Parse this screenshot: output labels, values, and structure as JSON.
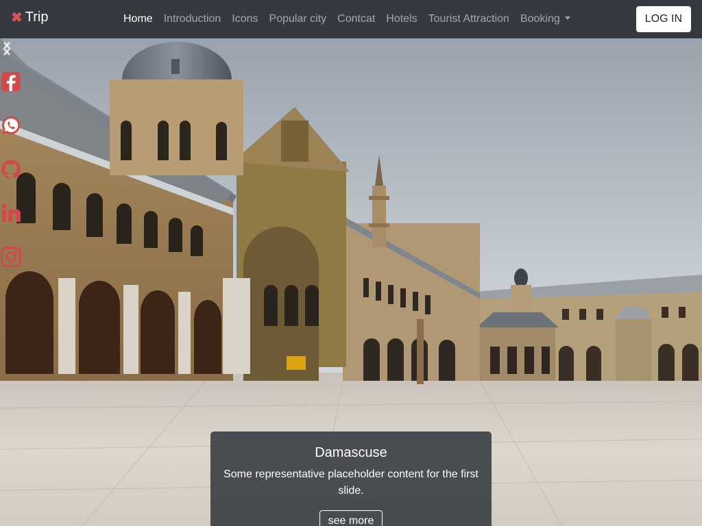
{
  "navbar": {
    "brand": {
      "icon": "x-mark-icon",
      "label": "Trip"
    },
    "links": [
      {
        "label": "Home",
        "active": true
      },
      {
        "label": "Introduction"
      },
      {
        "label": "Icons"
      },
      {
        "label": "Popular city"
      },
      {
        "label": "Contcat"
      },
      {
        "label": "Hotels"
      },
      {
        "label": "Tourist Attraction"
      },
      {
        "label": "Booking",
        "dropdown": true
      }
    ],
    "login_label": "LOG IN"
  },
  "social": [
    "facebook-icon",
    "whatsapp-icon",
    "github-icon",
    "linkedin-icon",
    "instagram-icon"
  ],
  "slide": {
    "title": "Damascuse",
    "text": "Some representative placeholder content for the first slide.",
    "button_label": "see more"
  },
  "colors": {
    "navbar": "#343a40",
    "brand_icon": "#d9534f",
    "social": "#d04a4a"
  }
}
